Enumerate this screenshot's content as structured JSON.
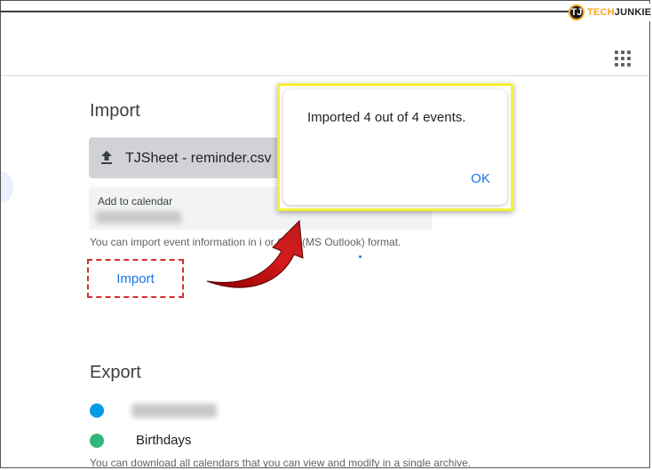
{
  "brand": {
    "logo_letter": "TJ",
    "text_part1": "TECH",
    "text_part2": "JUNKIE"
  },
  "import_section": {
    "heading": "Import",
    "file_name": "TJSheet - reminder.csv",
    "calendar_label": "Add to calendar",
    "help_text": "You can import event information in i     or CSV (MS Outlook) format.",
    "import_button": "Import"
  },
  "export_section": {
    "heading": "Export",
    "calendars": [
      {
        "label": "",
        "color": "#039be5"
      },
      {
        "label": "Birthdays",
        "color": "#33b679"
      }
    ],
    "help_text": "You can download all calendars that you can view and modify in a single archive."
  },
  "dialog": {
    "message": "Imported 4 out of 4 events.",
    "ok_label": "OK"
  },
  "colors": {
    "accent": "#1a73e8",
    "highlight_yellow": "#f5f03a",
    "annotation_red": "#d32f2f"
  },
  "icons": [
    "apps-grid-icon",
    "upload-icon",
    "techjunkie-logo"
  ]
}
